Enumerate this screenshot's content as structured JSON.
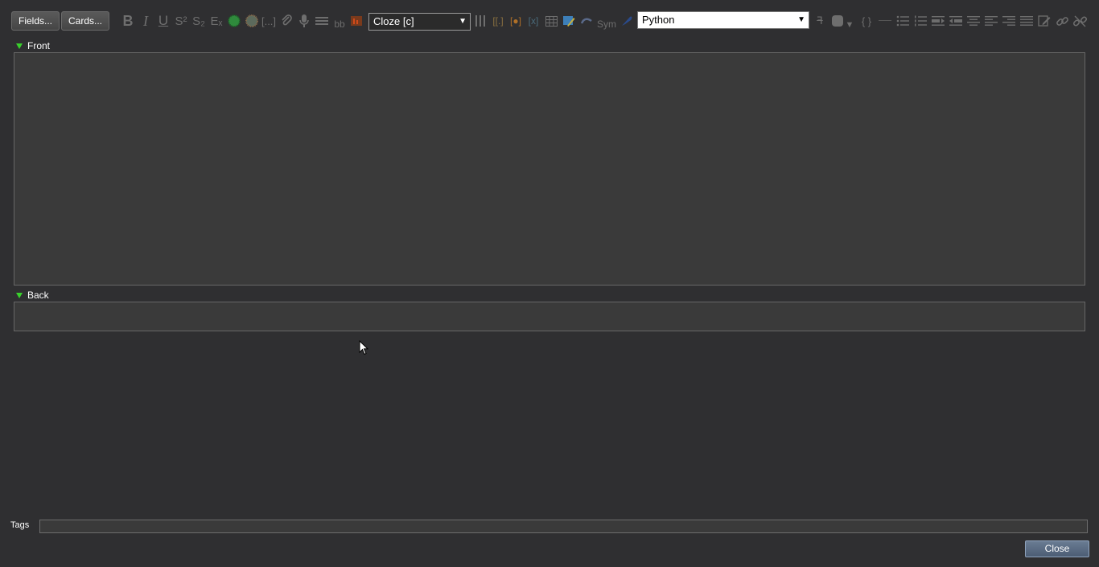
{
  "toolbar": {
    "fields_label": "Fields...",
    "cards_label": "Cards...",
    "bold_glyph": "B",
    "italic_glyph": "I",
    "underline_glyph": "U",
    "superscript_glyph": "S²",
    "subscript_glyph": "S₂",
    "clear_format_glyph": "Eₓ",
    "cloze_glyph": "[...]",
    "bb_glyph": "bb",
    "cloze_select_value": "Cloze [c]",
    "sym_label": "Sym",
    "language_select_value": "Python",
    "braces_glyph": "{ }"
  },
  "fields": [
    {
      "name": "Front"
    },
    {
      "name": "Back"
    }
  ],
  "tags": {
    "label": "Tags",
    "value": ""
  },
  "footer": {
    "close_label": "Close"
  },
  "colors": {
    "background": "#2f2f31",
    "field_background": "#3a3a3a",
    "collapse_arrow": "#39d12c",
    "close_button": "#5b6d84"
  }
}
